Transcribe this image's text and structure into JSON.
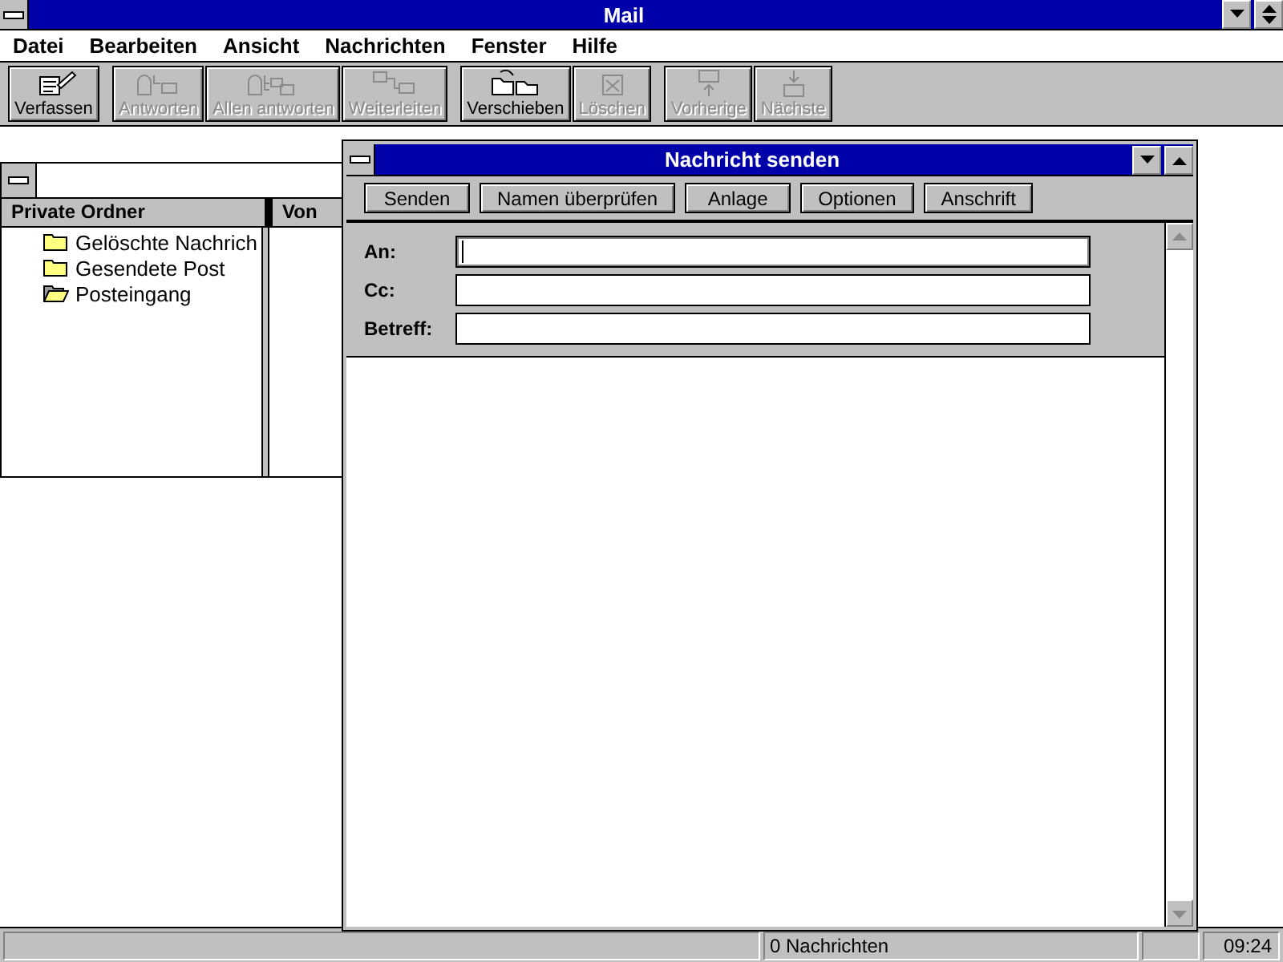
{
  "window": {
    "title": "Mail"
  },
  "menu": [
    {
      "label": "Datei"
    },
    {
      "label": "Bearbeiten"
    },
    {
      "label": "Ansicht"
    },
    {
      "label": "Nachrichten"
    },
    {
      "label": "Fenster"
    },
    {
      "label": "Hilfe"
    }
  ],
  "toolbar_groups": [
    [
      {
        "label": "Verfassen",
        "kind": "compose",
        "disabled": false
      }
    ],
    [
      {
        "label": "Antworten",
        "kind": "reply",
        "disabled": true
      },
      {
        "label": "Allen antworten",
        "kind": "replyall",
        "disabled": true
      },
      {
        "label": "Weiterleiten",
        "kind": "forward",
        "disabled": true
      }
    ],
    [
      {
        "label": "Verschieben",
        "kind": "move",
        "disabled": false
      },
      {
        "label": "Löschen",
        "kind": "delete",
        "disabled": true
      }
    ],
    [
      {
        "label": "Vorherige",
        "kind": "previous",
        "disabled": true
      },
      {
        "label": "Nächste",
        "kind": "next",
        "disabled": true
      }
    ]
  ],
  "folder_window": {
    "columns": [
      "Private Ordner",
      "Von"
    ],
    "folders": [
      {
        "name": "Gelöschte Nachrich",
        "open": false
      },
      {
        "name": "Gesendete Post",
        "open": false
      },
      {
        "name": "Posteingang",
        "open": true
      }
    ]
  },
  "compose_window": {
    "title": "Nachricht senden",
    "buttons": [
      "Senden",
      "Namen überprüfen",
      "Anlage",
      "Optionen",
      "Anschrift"
    ],
    "fields": [
      {
        "label": "An:",
        "focused": true
      },
      {
        "label": "Cc:",
        "focused": false
      },
      {
        "label": "Betreff:",
        "focused": false
      }
    ]
  },
  "status_bar": {
    "message": "0 Nachrichten",
    "time": "09:24"
  }
}
